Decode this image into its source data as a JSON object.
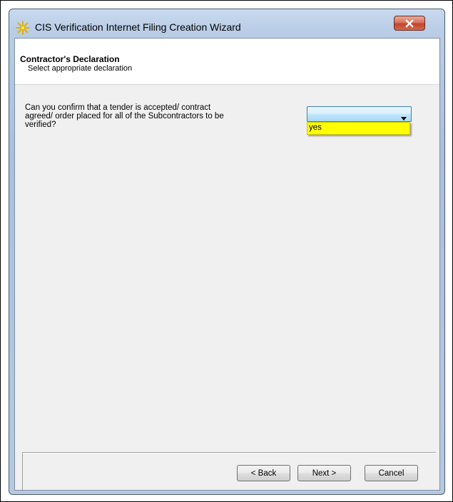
{
  "window": {
    "title": "CIS Verification Internet Filing Creation Wizard",
    "icon": "sparkle-icon",
    "close_icon": "close-icon"
  },
  "header": {
    "title": "Contractor's Declaration",
    "subtitle": "Select appropriate declaration"
  },
  "question": {
    "line1": "Can you confirm that a tender is accepted/ contract",
    "line2": "agreed/ order placed for all of the Subcontractors to be",
    "line3": "verified?"
  },
  "dropdown": {
    "selected_value": "",
    "options": [
      "yes"
    ],
    "highlight_color": "#ffff00"
  },
  "buttons": {
    "back": "< Back",
    "next": "Next >",
    "cancel": "Cancel"
  }
}
